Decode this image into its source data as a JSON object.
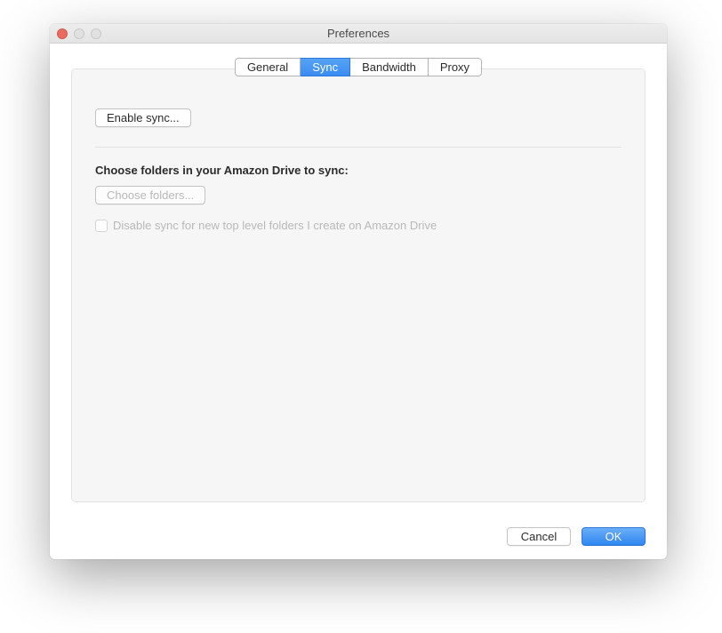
{
  "window": {
    "title": "Preferences"
  },
  "tabs": {
    "general": "General",
    "sync": "Sync",
    "bandwidth": "Bandwidth",
    "proxy": "Proxy"
  },
  "sync_panel": {
    "enable_sync_label": "Enable sync...",
    "choose_folders_heading": "Choose folders in your Amazon Drive to sync:",
    "choose_folders_button": "Choose folders...",
    "disable_sync_checkbox_label": "Disable sync for new top level folders I create on Amazon Drive"
  },
  "footer": {
    "cancel_label": "Cancel",
    "ok_label": "OK"
  }
}
